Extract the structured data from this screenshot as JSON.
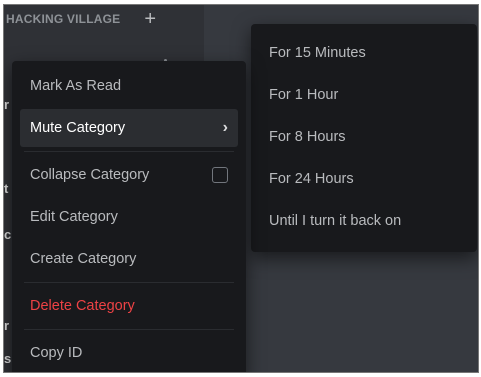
{
  "sidebar": {
    "category_name": "HACKING VILLAGE",
    "add_symbol": "+",
    "edge_glyphs": [
      "r",
      "t",
      "c",
      "r",
      "s"
    ]
  },
  "context_menu": {
    "items": [
      {
        "label": "Mark As Read"
      },
      {
        "label": "Mute Category",
        "submenu_chevron": "›"
      },
      {
        "label": "Collapse Category"
      },
      {
        "label": "Edit Category"
      },
      {
        "label": "Create Category"
      },
      {
        "label": "Delete Category"
      },
      {
        "label": "Copy ID"
      }
    ]
  },
  "mute_submenu": {
    "items": [
      {
        "label": "For 15 Minutes"
      },
      {
        "label": "For 1 Hour"
      },
      {
        "label": "For 8 Hours"
      },
      {
        "label": "For 24 Hours"
      },
      {
        "label": "Until I turn it back on"
      }
    ]
  },
  "colors": {
    "menu_background": "#18191c",
    "menu_text": "#b9bbbe",
    "active_background": "#2b2d31",
    "danger": "#ed4245",
    "sidebar_background": "#2f3136",
    "app_background": "#36393f"
  }
}
